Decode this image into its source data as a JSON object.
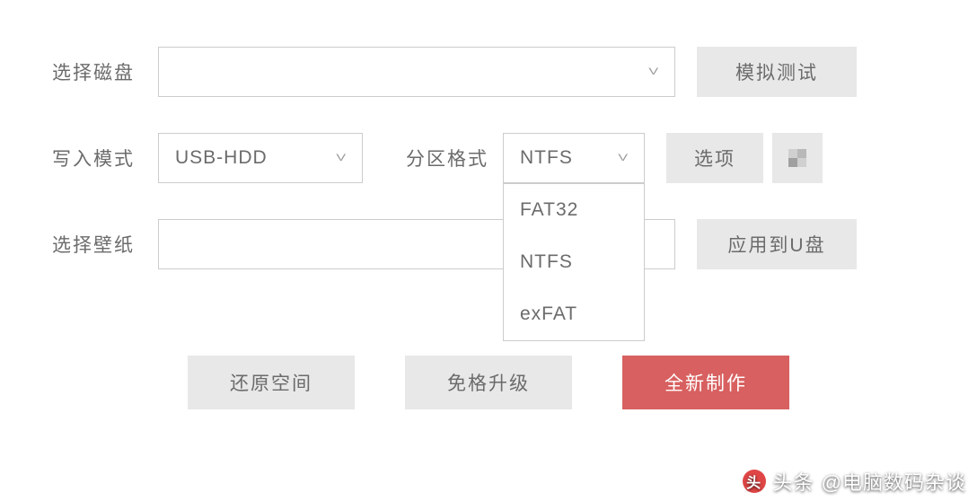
{
  "labels": {
    "select_disk": "选择磁盘",
    "write_mode": "写入模式",
    "partition_format": "分区格式",
    "select_wallpaper": "选择壁纸"
  },
  "selects": {
    "disk_value": "",
    "write_mode_value": "USB-HDD",
    "partition_format_value": "NTFS",
    "wallpaper_value": ""
  },
  "partition_options": [
    "FAT32",
    "NTFS",
    "exFAT"
  ],
  "buttons": {
    "simulate_test": "模拟测试",
    "options": "选项",
    "apply_to_usb": "应用到U盘",
    "restore_space": "还原空间",
    "upgrade_no_format": "免格升级",
    "create_new": "全新制作"
  },
  "watermark": {
    "prefix": "头条",
    "handle": "@电脑数码杂谈"
  }
}
